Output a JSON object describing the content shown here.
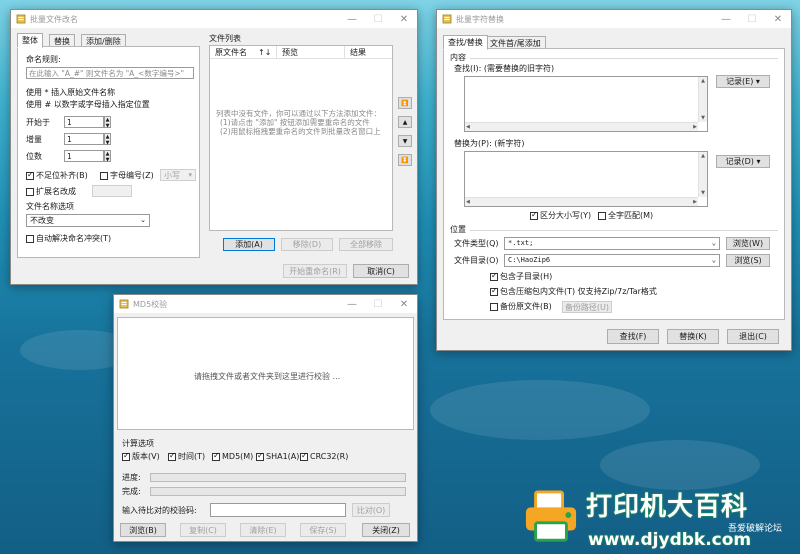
{
  "rename_window": {
    "title": "批量文件改名",
    "tabs": [
      "整体",
      "替换",
      "添加/删除"
    ],
    "naming_rule_label": "命名规则:",
    "naming_rule_placeholder": "在此输入 \"A_#\" 则文件名为 \"A_<数字编号>\"",
    "hint_line1": "使用 * 插入原始文件名称",
    "hint_line2": "使用 # 以数字或字母插入指定位置",
    "start_label": "开始于",
    "start_value": "1",
    "increment_label": "增量",
    "increment_value": "1",
    "digits_label": "位数",
    "digits_value": "1",
    "pad_label": "不足位补齐(B)",
    "pad_checked": true,
    "letter_label": "字母编号(Z)",
    "letter_checked": false,
    "case_value": "小写",
    "ext_label": "扩展名改成",
    "ext_checked": false,
    "name_option_label": "文件名称选项",
    "name_option_value": "不改变",
    "auto_resolve_label": "自动解决命名冲突(T)",
    "auto_resolve_checked": false,
    "file_list_label": "文件列表",
    "columns": [
      "原文件名",
      "预览",
      "结果"
    ],
    "sort_arrows": "↑↓",
    "empty_lines": [
      "列表中没有文件，你可以通过以下方法添加文件：",
      "(1)请点击 \"添加\" 按钮添加需要重命名的文件",
      "(2)用鼠标拖拽要重命名的文件到批量改名窗口上"
    ],
    "side_buttons": [
      "⏫",
      "▲",
      "▼",
      "⏬"
    ],
    "add_button": "添加(A)",
    "remove_button": "移除(D)",
    "remove_all_button": "全部移除",
    "start_rename_button": "开始重命名(R)",
    "cancel_button": "取消(C)"
  },
  "replace_window": {
    "title": "批量字符替换",
    "tabs": [
      "查找/替换",
      "文件首/尾添加"
    ],
    "content_label": "内容",
    "find_label": "查找(I): (需要替换的旧字符)",
    "record_button_1": "记录(E) ▾",
    "replace_label": "替换为(P): (新字符)",
    "record_button_2": "记录(D) ▾",
    "case_label": "区分大小写(Y)",
    "case_checked": true,
    "whole_label": "全字匹配(M)",
    "whole_checked": false,
    "location_label": "位置",
    "file_type_label": "文件类型(Q)",
    "file_type_value": "*.txt;",
    "browse1": "浏览(W)",
    "dir_label": "文件目录(O)",
    "dir_value": "C:\\HaoZip6",
    "browse2": "浏览(S)",
    "subdir_label": "包含子目录(H)",
    "subdir_checked": true,
    "archive_label": "包含压缩包内文件(T) 仅支持Zip/7z/Tar格式",
    "archive_checked": true,
    "backup_label": "备份原文件(B)",
    "backup_checked": false,
    "backup_path_button": "备份路径(U)",
    "find_button": "查找(F)",
    "replace_button": "替换(K)",
    "exit_button": "退出(C)"
  },
  "md5_window": {
    "title": "MD5校验",
    "drop_hint": "请拖拽文件或者文件夹到这里进行校验 ...",
    "calc_label": "计算选项",
    "options": [
      {
        "label": "版本(V)",
        "checked": true
      },
      {
        "label": "时间(T)",
        "checked": true
      },
      {
        "label": "MD5(M)",
        "checked": true
      },
      {
        "label": "SHA1(A)",
        "checked": true
      },
      {
        "label": "CRC32(R)",
        "checked": true
      }
    ],
    "progress_label": "进度:",
    "progress_value": 0,
    "complete_label": "完成:",
    "complete_value": 0,
    "checksum_label": "输入待比对的校验码:",
    "checksum_value": "",
    "compare_button": "比对(O)",
    "browse_button": "浏览(B)",
    "copy_button": "复制(C)",
    "clear_button": "清除(E)",
    "save_button": "保存(S)",
    "close_button": "关闭(Z)"
  },
  "watermark": {
    "text_main": "打印机大百科",
    "text_sub": "吾爱破解论坛",
    "url": "www.djydbk.com"
  },
  "colors": {
    "accent": "#0078d7",
    "progress": "#06b025",
    "watermark_green": "#2ba24c",
    "watermark_orange": "#f5a623"
  }
}
